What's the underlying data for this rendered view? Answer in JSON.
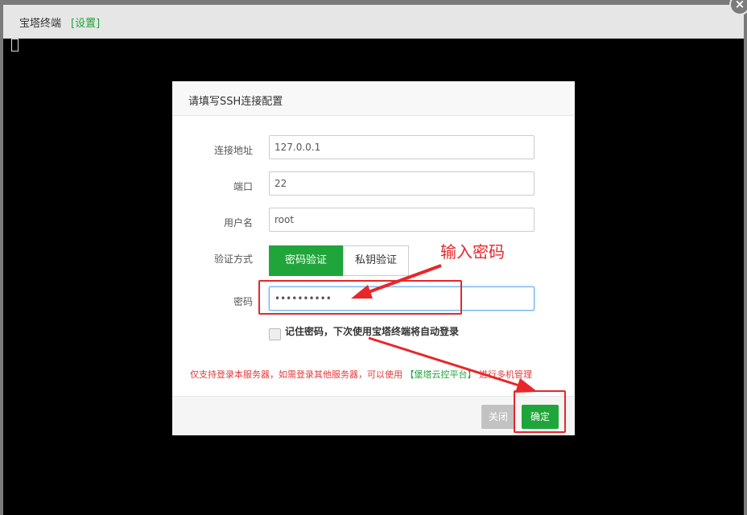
{
  "window": {
    "title": "宝塔终端",
    "settings_link": "[设置]",
    "close_symbol": "×"
  },
  "dialog": {
    "title": "请填写SSH连接配置",
    "fields": {
      "host": {
        "label": "连接地址",
        "value": "127.0.0.1"
      },
      "port": {
        "label": "端口",
        "value": "22"
      },
      "username": {
        "label": "用户名",
        "value": "root"
      },
      "auth_method": {
        "label": "验证方式",
        "options": [
          "密码验证",
          "私钥验证"
        ],
        "selected": "密码验证"
      },
      "password": {
        "label": "密码",
        "value": "••••••••••"
      }
    },
    "remember": {
      "label": "记住密码，下次使用宝塔终端将自动登录",
      "checked": false
    },
    "notice": {
      "prefix": "仅支持登录本服务器，如需登录其他服务器，可以使用",
      "link": "【堡塔云控平台】",
      "suffix": "进行多机管理"
    },
    "buttons": {
      "close": "关闭",
      "confirm": "确定"
    }
  },
  "annotation": {
    "text": "输入密码"
  },
  "colors": {
    "brand_green": "#20a53a",
    "annotation_red": "#e8262a",
    "notice_red": "#e03a3a"
  }
}
